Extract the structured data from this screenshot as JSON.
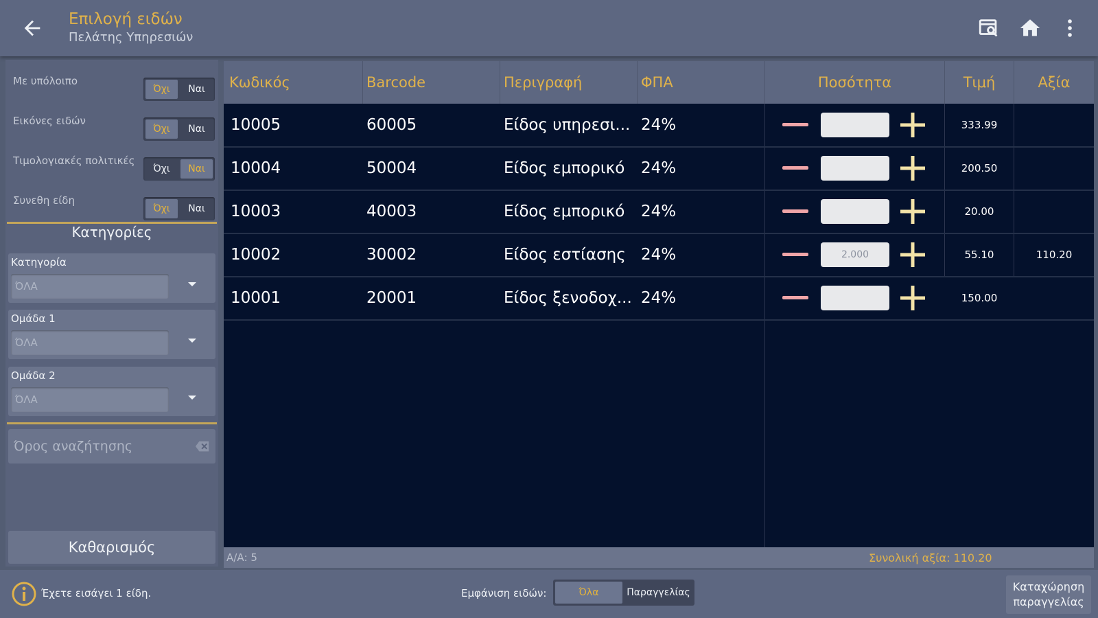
{
  "header": {
    "title": "Επιλογή ειδών",
    "subtitle": "Πελάτης Υπηρεσιών",
    "icons": [
      "back-arrow-icon",
      "scan-icon",
      "home-icon",
      "more-vert-icon"
    ]
  },
  "filters": {
    "toggles": [
      {
        "label": "Με υπόλοιπο",
        "off": "Όχι",
        "on": "Ναι",
        "selected": "Όχι"
      },
      {
        "label": "Εικόνες ειδών",
        "off": "Όχι",
        "on": "Ναι",
        "selected": "Όχι"
      },
      {
        "label": "Τιμολογιακές πολιτικές",
        "off": "Όχι",
        "on": "Ναι",
        "selected": "Ναι"
      },
      {
        "label": "Συνεθη είδη",
        "off": "Όχι",
        "on": "Ναι",
        "selected": "Όχι"
      }
    ],
    "categories_title": "Κατηγορίες",
    "selects": [
      {
        "label": "Κατηγορία",
        "value": "ΌΛΑ"
      },
      {
        "label": "Ομάδα 1",
        "value": "ΌΛΑ"
      },
      {
        "label": "Ομάδα 2",
        "value": "ΌΛΑ"
      }
    ],
    "search_placeholder": "Όρος αναζήτησης",
    "clear_label": "Καθαρισμός"
  },
  "table": {
    "columns": [
      "Κωδικός",
      "Barcode",
      "Περιγραφή",
      "ΦΠΑ",
      "Ποσότητα",
      "Τιμή",
      "Αξία"
    ],
    "rows": [
      {
        "code": "10005",
        "barcode": "60005",
        "desc": "Είδος υπηρεσι...",
        "vat": "24%",
        "qty": "",
        "price": "333.99",
        "value": ""
      },
      {
        "code": "10004",
        "barcode": "50004",
        "desc": "Είδος εμπορικό",
        "vat": "24%",
        "qty": "",
        "price": "200.50",
        "value": ""
      },
      {
        "code": "10003",
        "barcode": "40003",
        "desc": "Είδος εμπορικό",
        "vat": "24%",
        "qty": "",
        "price": "20.00",
        "value": ""
      },
      {
        "code": "10002",
        "barcode": "30002",
        "desc": "Είδος εστίασης",
        "vat": "24%",
        "qty": "2.000",
        "price": "55.10",
        "value": "110.20"
      },
      {
        "code": "10001",
        "barcode": "20001",
        "desc": "Είδος ξενοδοχ...",
        "vat": "24%",
        "qty": "",
        "price": "150.00",
        "value": ""
      }
    ],
    "footer_count": "Α/Α: 5",
    "footer_total": "Συνολική αξία: 110.20"
  },
  "bottom": {
    "info_text": "Έχετε εισάγει 1 είδη.",
    "show_label": "Εμφάνιση ειδών:",
    "show_options": [
      "Όλα",
      "Παραγγελίας"
    ],
    "show_selected": "Όλα",
    "submit_line1": "Καταχώρηση",
    "submit_line2": "παραγγελίας"
  },
  "colors": {
    "accent": "#e0b24a",
    "header_bg": "#5d6781",
    "table_bg": "#04112c",
    "minus": "#f0a5a8",
    "plus": "#f3e3a8"
  }
}
